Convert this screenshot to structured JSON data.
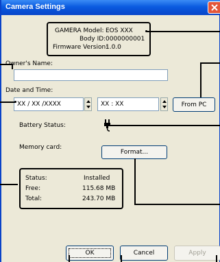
{
  "window": {
    "title": "Camera Settings"
  },
  "info": {
    "model_label": "GAMERA Model:",
    "model_value": "EOS XXX",
    "body_label": "Body ID:",
    "body_value": "0000000001",
    "firmware_label": "Firmware Version:",
    "firmware_value": "1.0.0"
  },
  "owner": {
    "label": "Owner's Name:",
    "value": ""
  },
  "datetime": {
    "label": "Date and Time:",
    "date_value": "XX  /  XX  /XXXX",
    "time_value": "XX   :   XX",
    "from_pc_label": "From PC"
  },
  "battery": {
    "label": "Battery Status:",
    "icon": "power-plug-icon"
  },
  "memory": {
    "label": "Memory card:",
    "format_label": "Format...",
    "status_label": "Status:",
    "status_value": "Installed",
    "free_label": "Free:",
    "free_value": "115.68  MB",
    "total_label": "Total:",
    "total_value": "243.70  MB"
  },
  "buttons": {
    "ok": "OK",
    "cancel": "Cancel",
    "apply": "Apply"
  },
  "colors": {
    "titlebar": "#0a5be0",
    "close": "#e3563a",
    "dialog_bg": "#ece9d8"
  }
}
